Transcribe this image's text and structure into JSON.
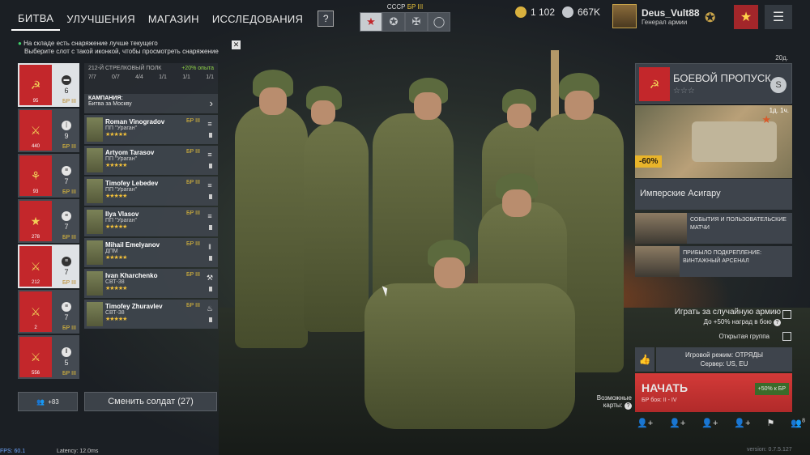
{
  "nav": {
    "tabs": [
      "БИТВА",
      "УЛУЧШЕНИЯ",
      "МАГАЗИН",
      "ИССЛЕДОВАНИЯ"
    ],
    "help": "?"
  },
  "nation": {
    "label": "СССР",
    "br": "БР III",
    "buttons": [
      "star-icon",
      "allies-icon",
      "cross-icon",
      "circle-icon"
    ]
  },
  "currency": {
    "gold": "1 102",
    "silver": "667K"
  },
  "profile": {
    "name": "Deus_Vult88",
    "rank": "Генерал армии"
  },
  "notice": {
    "line1": "На складе есть снаряжение лучше текущего",
    "line2": "Выберите слот с такой иконкой, чтобы просмотреть снаряжение",
    "close": "✕"
  },
  "squads": [
    {
      "icon": "car-icon",
      "count": "6",
      "level": "95",
      "br": "БР III",
      "selected": true
    },
    {
      "icon": "rifle-icon",
      "count": "9",
      "level": "440",
      "br": "БР III",
      "selected": false
    },
    {
      "icon": "list-icon",
      "count": "7",
      "level": "93",
      "br": "БР III",
      "selected": false
    },
    {
      "icon": "list-icon",
      "count": "7",
      "level": "278",
      "br": "БР III",
      "selected": false
    },
    {
      "icon": "list-icon",
      "count": "7",
      "level": "212",
      "br": "БР III",
      "selected": true
    },
    {
      "icon": "list-icon",
      "count": "7",
      "level": "2",
      "br": "БР III",
      "selected": false
    },
    {
      "icon": "bars-icon",
      "count": "5",
      "level": "556",
      "br": "БР III",
      "selected": false
    }
  ],
  "unit": {
    "title": "212-Й СТРЕЛКОВЫЙ ПОЛК",
    "xp": "+20% опыта",
    "stats": [
      "7/7",
      "0/7",
      "4/4",
      "1/1",
      "1/1",
      "1/1"
    ],
    "campaign_label": "КАМПАНИЯ:",
    "campaign_value": "Битва за Москву"
  },
  "soldiers": [
    {
      "name": "Roman Vinogradov",
      "weapon": "ПП \"Ураган\"",
      "stars": "★★★★★",
      "br": "БР III",
      "cls": "list-icon"
    },
    {
      "name": "Artyom Tarasov",
      "weapon": "ПП \"Ураган\"",
      "stars": "★★★★★",
      "br": "БР III",
      "cls": "list-icon"
    },
    {
      "name": "Timofey Lebedev",
      "weapon": "ПП \"Ураган\"",
      "stars": "★★★★★",
      "br": "БР III",
      "cls": "list-icon"
    },
    {
      "name": "Ilya Vlasov",
      "weapon": "ПП \"Ураган\"",
      "stars": "★★★★★",
      "br": "БР III",
      "cls": "list-icon"
    },
    {
      "name": "Mihail Emelyanov",
      "weapon": "ДПМ",
      "stars": "★★★★★",
      "br": "БР III",
      "cls": "bars-icon"
    },
    {
      "name": "Ivan Kharchenko",
      "weapon": "СВТ-38",
      "stars": "★★★★★",
      "br": "БР III",
      "cls": "wrench-icon"
    },
    {
      "name": "Timofey Zhuravlev",
      "weapon": "СВТ-38",
      "stars": "★★★★★",
      "br": "БР III",
      "cls": "fire-icon"
    }
  ],
  "bottom": {
    "squad_count": "+83",
    "change_label": "Сменить солдат (27)"
  },
  "battlepass": {
    "title": "БОЕВОЙ ПРОПУСК",
    "stars": "☆☆☆",
    "days": "20д.",
    "coin": "S"
  },
  "promo": {
    "discount": "-60%",
    "days": "1д. 1ч.",
    "title": "Имперские Асигару"
  },
  "news": [
    {
      "text": "СОБЫТИЯ И ПОЛЬЗОВАТЕЛЬСКИЕ МАТЧИ"
    },
    {
      "text": "ПРИБЫЛО ПОДКРЕПЛЕНИЕ: ВИНТАЖНЫЙ АРСЕНАЛ"
    }
  ],
  "options": {
    "random_army": "Играть за случайную армию",
    "reward_note": "До +50% наград в бою",
    "open_group": "Открытая группа"
  },
  "mode": {
    "line1": "Игровой режим: ОТРЯДЫ",
    "line2": "Сервер: US, EU"
  },
  "start": {
    "label": "НАЧАТЬ",
    "br": "БР боя: II - IV",
    "xp": "+50% к БР"
  },
  "maps": {
    "label": "Возможные карты:"
  },
  "party": {
    "count": "8"
  },
  "debug": {
    "fps": "FPS: 60.1",
    "latency": "Latency: 12.0ms",
    "version": "version: 0.7.5.127"
  },
  "colors": {
    "accent_red": "#c3272b",
    "gold": "#e9c23a",
    "panel": "#3e444c"
  }
}
